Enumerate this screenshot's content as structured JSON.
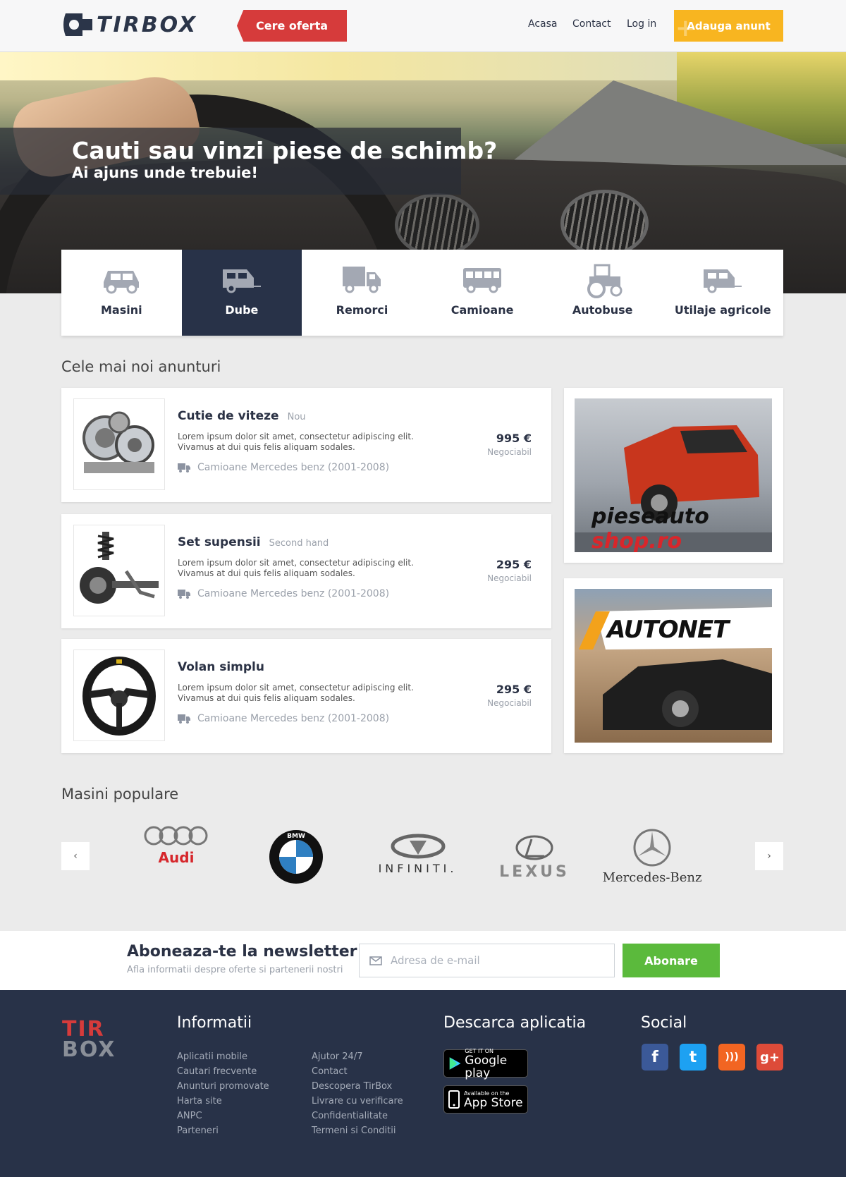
{
  "header": {
    "logo_text": "TIRBOX",
    "cere_oferta": "Cere oferta",
    "nav": [
      "Acasa",
      "Contact",
      "Log in"
    ],
    "adauga_anunt": "Adauga anunt"
  },
  "hero": {
    "title": "Cauti sau vinzi piese de schimb?",
    "subtitle": "Ai ajuns unde trebuie!"
  },
  "categories": [
    {
      "label": "Masini",
      "icon": "car-icon",
      "active": false
    },
    {
      "label": "Dube",
      "icon": "van-icon",
      "active": true
    },
    {
      "label": "Remorci",
      "icon": "truck-icon",
      "active": false
    },
    {
      "label": "Camioane",
      "icon": "bus-icon",
      "active": false
    },
    {
      "label": "Autobuse",
      "icon": "tractor-icon",
      "active": false
    },
    {
      "label": "Utilaje agricole",
      "icon": "trailer-icon",
      "active": false
    }
  ],
  "latest": {
    "title": "Cele mai noi anunturi",
    "items": [
      {
        "title": "Cutie de viteze",
        "tag": "Nou",
        "desc": "Lorem ipsum dolor sit amet, consectetur adipiscing elit. Vivamus at dui quis felis aliquam sodales.",
        "category": "Camioane Mercedes benz (2001-2008)",
        "price": "995 €",
        "negotiable": "Negociabil",
        "image": "gearbox-image"
      },
      {
        "title": "Set supensii",
        "tag": "Second hand",
        "desc": "Lorem ipsum dolor sit amet, consectetur adipiscing elit. Vivamus at dui quis felis aliquam sodales.",
        "category": "Camioane Mercedes benz (2001-2008)",
        "price": "295 €",
        "negotiable": "Negociabil",
        "image": "suspension-image"
      },
      {
        "title": "Volan simplu",
        "tag": "",
        "desc": "Lorem ipsum dolor sit amet, consectetur adipiscing elit. Vivamus at dui quis felis aliquam sodales.",
        "category": "Camioane Mercedes benz (2001-2008)",
        "price": "295 €",
        "negotiable": "Negociabil",
        "image": "steering-wheel-image"
      }
    ]
  },
  "ads": [
    {
      "text_a": "pieseauto",
      "text_b": "shop.ro"
    },
    {
      "text": "AUTONET"
    }
  ],
  "popular": {
    "title": "Masini populare",
    "brands": [
      "Audi",
      "BMW",
      "INFINITI.",
      "LEXUS",
      "Mercedes-Benz"
    ],
    "prev": "‹",
    "next": "›"
  },
  "newsletter": {
    "title": "Aboneaza-te la newsletter",
    "subtitle": "Afla informatii despre oferte si partenerii nostri",
    "placeholder": "Adresa de e-mail",
    "button": "Abonare"
  },
  "footer": {
    "logo_top": "TIR",
    "logo_bottom": "BOX",
    "info_title": "Informatii",
    "col1": [
      "Aplicatii mobile",
      "Cautari frecvente",
      "Anunturi promovate",
      "Harta site",
      "ANPC",
      "Parteneri"
    ],
    "col2": [
      "Ajutor 24/7",
      "Contact",
      "Descopera TirBox",
      "Livrare cu verificare",
      "Confidentialitate",
      "Termeni si Conditii"
    ],
    "app_title": "Descarca aplicatia",
    "google_small": "GET IT ON",
    "google_big": "Google play",
    "apple_small": "Available on the",
    "apple_big": "App Store",
    "social_title": "Social",
    "social": [
      {
        "name": "facebook-icon",
        "glyph": "f",
        "color": "#3b5998"
      },
      {
        "name": "twitter-icon",
        "glyph": "t",
        "color": "#1da1f2"
      },
      {
        "name": "rss-icon",
        "glyph": ")))",
        "color": "#f26522"
      },
      {
        "name": "google-plus-icon",
        "glyph": "g+",
        "color": "#dd4b39"
      }
    ]
  }
}
